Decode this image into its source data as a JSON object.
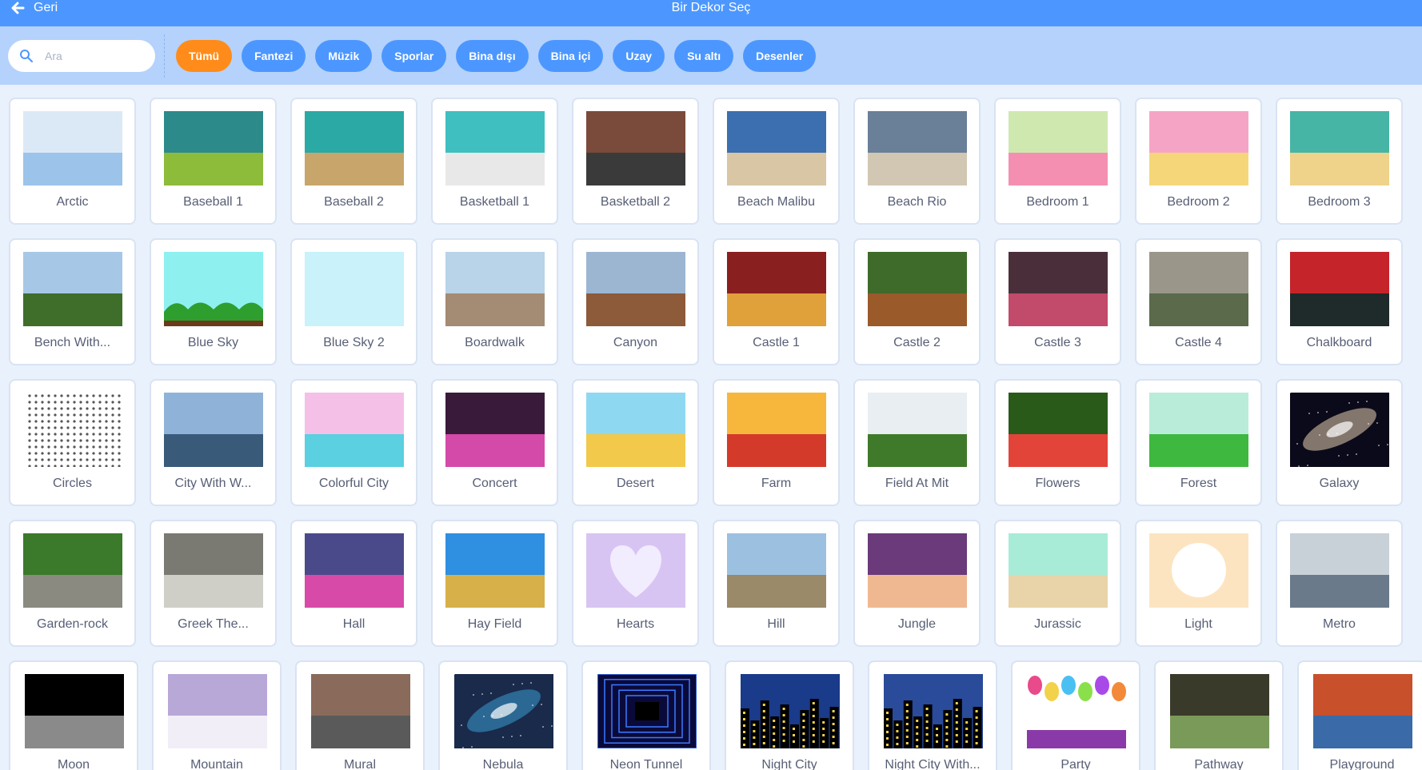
{
  "header": {
    "back_label": "Geri",
    "title": "Bir Dekor Seç"
  },
  "search": {
    "placeholder": "Ara"
  },
  "tags": [
    {
      "label": "Tümü",
      "active": true
    },
    {
      "label": "Fantezi"
    },
    {
      "label": "Müzik"
    },
    {
      "label": "Sporlar"
    },
    {
      "label": "Bina dışı"
    },
    {
      "label": "Bina içi"
    },
    {
      "label": "Uzay"
    },
    {
      "label": "Su altı"
    },
    {
      "label": "Desenler"
    }
  ],
  "rows": [
    [
      {
        "name": "Arctic",
        "icon": "arctic-thumbnail",
        "colors": [
          "#dbe9f7",
          "#9cc3ea"
        ]
      },
      {
        "name": "Baseball 1",
        "icon": "baseball-field-thumbnail",
        "colors": [
          "#2c8a8a",
          "#8dbb3a"
        ]
      },
      {
        "name": "Baseball 2",
        "icon": "baseball-diamond-thumbnail",
        "colors": [
          "#2aa9a5",
          "#c8a56a"
        ]
      },
      {
        "name": "Basketball 1",
        "icon": "basketball-court-thumbnail",
        "colors": [
          "#3fbfc0",
          "#e8e8e8"
        ]
      },
      {
        "name": "Basketball 2",
        "icon": "basketball-building-thumbnail",
        "colors": [
          "#7a4a3a",
          "#3a3a3a"
        ]
      },
      {
        "name": "Beach Malibu",
        "icon": "beach-thumbnail",
        "colors": [
          "#3b6fb0",
          "#d8c6a4"
        ]
      },
      {
        "name": "Beach Rio",
        "icon": "beach-mountain-thumbnail",
        "colors": [
          "#6a7f98",
          "#d2c7b2"
        ]
      },
      {
        "name": "Bedroom 1",
        "icon": "bedroom-thumbnail",
        "colors": [
          "#cfe8b0",
          "#f48fb1"
        ]
      },
      {
        "name": "Bedroom 2",
        "icon": "bedroom-thumbnail",
        "colors": [
          "#f6a4c6",
          "#f5d77a"
        ]
      },
      {
        "name": "Bedroom 3",
        "icon": "bedroom-thumbnail",
        "colors": [
          "#46b5a5",
          "#f0d38a"
        ]
      }
    ],
    [
      {
        "name": "Bench With...",
        "icon": "bench-landscape-thumbnail",
        "colors": [
          "#a7c7e7",
          "#3f6e2a"
        ]
      },
      {
        "name": "Blue Sky",
        "icon": "blue-sky-thumbnail",
        "colors": [
          "#8ff0f0",
          "#2e9e2e"
        ]
      },
      {
        "name": "Blue Sky 2",
        "icon": "blue-sky-thumbnail",
        "colors": [
          "#c9f2fb",
          "#c9f2fb"
        ]
      },
      {
        "name": "Boardwalk",
        "icon": "boardwalk-thumbnail",
        "colors": [
          "#b9d3e8",
          "#a48b73"
        ]
      },
      {
        "name": "Canyon",
        "icon": "canyon-thumbnail",
        "colors": [
          "#9cb6d2",
          "#8d5a3a"
        ]
      },
      {
        "name": "Castle 1",
        "icon": "castle-door-thumbnail",
        "colors": [
          "#8a1f1f",
          "#e0a03a"
        ]
      },
      {
        "name": "Castle 2",
        "icon": "castle-forest-thumbnail",
        "colors": [
          "#3e6b2a",
          "#9a5a2a"
        ]
      },
      {
        "name": "Castle 3",
        "icon": "castle-hall-thumbnail",
        "colors": [
          "#4a2f3a",
          "#c24a6a"
        ]
      },
      {
        "name": "Castle 4",
        "icon": "castle-ruin-thumbnail",
        "colors": [
          "#9a968a",
          "#5a6a4a"
        ]
      },
      {
        "name": "Chalkboard",
        "icon": "chalkboard-thumbnail",
        "colors": [
          "#c4242a",
          "#1f2a2a"
        ]
      }
    ],
    [
      {
        "name": "Circles",
        "icon": "circles-pattern-thumbnail",
        "colors": [
          "#ffffff",
          "#555555"
        ]
      },
      {
        "name": "City With W...",
        "icon": "city-water-thumbnail",
        "colors": [
          "#8fb3d8",
          "#3a5a7a"
        ]
      },
      {
        "name": "Colorful City",
        "icon": "colorful-city-thumbnail",
        "colors": [
          "#f4c0e8",
          "#5ad0e0"
        ]
      },
      {
        "name": "Concert",
        "icon": "concert-stage-thumbnail",
        "colors": [
          "#3a1a3a",
          "#d44aa8"
        ]
      },
      {
        "name": "Desert",
        "icon": "desert-thumbnail",
        "colors": [
          "#8fd8f2",
          "#f2c94a"
        ]
      },
      {
        "name": "Farm",
        "icon": "farm-thumbnail",
        "colors": [
          "#f6b73c",
          "#d43a2a"
        ]
      },
      {
        "name": "Field At Mit",
        "icon": "building-field-thumbnail",
        "colors": [
          "#e8eef2",
          "#3f7a2a"
        ]
      },
      {
        "name": "Flowers",
        "icon": "flowers-thumbnail",
        "colors": [
          "#2a5a1a",
          "#e2443a"
        ]
      },
      {
        "name": "Forest",
        "icon": "forest-thumbnail",
        "colors": [
          "#b9ecd9",
          "#3fb83f"
        ]
      },
      {
        "name": "Galaxy",
        "icon": "galaxy-thumbnail",
        "colors": [
          "#0a0a1a",
          "#e8d0b0"
        ]
      }
    ],
    [
      {
        "name": "Garden-rock",
        "icon": "garden-rock-thumbnail",
        "colors": [
          "#3a7a2a",
          "#8a8a80"
        ]
      },
      {
        "name": "Greek The...",
        "icon": "greek-theater-thumbnail",
        "colors": [
          "#7a7a72",
          "#cfcfc8"
        ]
      },
      {
        "name": "Hall",
        "icon": "hall-thumbnail",
        "colors": [
          "#4a4a8a",
          "#d84aa8"
        ]
      },
      {
        "name": "Hay Field",
        "icon": "hay-field-thumbnail",
        "colors": [
          "#2f8fe0",
          "#d8b04a"
        ]
      },
      {
        "name": "Hearts",
        "icon": "heart-thumbnail",
        "colors": [
          "#d8c4f2",
          "#f2ecff"
        ]
      },
      {
        "name": "Hill",
        "icon": "hill-thumbnail",
        "colors": [
          "#9cc0e0",
          "#9a8a6a"
        ]
      },
      {
        "name": "Jungle",
        "icon": "jungle-thumbnail",
        "colors": [
          "#6a3a7a",
          "#f0b890"
        ]
      },
      {
        "name": "Jurassic",
        "icon": "jurassic-thumbnail",
        "colors": [
          "#a8ecd8",
          "#e8d4a8"
        ]
      },
      {
        "name": "Light",
        "icon": "light-thumbnail",
        "colors": [
          "#fde4c0",
          "#ffffff"
        ]
      },
      {
        "name": "Metro",
        "icon": "metro-city-thumbnail",
        "colors": [
          "#c8d0d8",
          "#6a7a8a"
        ]
      }
    ],
    [
      {
        "name": "Moon",
        "icon": "moon-surface-thumbnail",
        "colors": [
          "#000000",
          "#8a8a8a"
        ]
      },
      {
        "name": "Mountain",
        "icon": "mountain-thumbnail",
        "colors": [
          "#b8a8d8",
          "#f2eef8"
        ]
      },
      {
        "name": "Mural",
        "icon": "mural-thumbnail",
        "colors": [
          "#8a6a5a",
          "#5a5a5a"
        ]
      },
      {
        "name": "Nebula",
        "icon": "nebula-thumbnail",
        "colors": [
          "#1a2a4a",
          "#3a9ad0"
        ]
      },
      {
        "name": "Neon Tunnel",
        "icon": "neon-tunnel-thumbnail",
        "colors": [
          "#0a0a3a",
          "#3a7aff"
        ]
      },
      {
        "name": "Night City",
        "icon": "night-city-thumbnail",
        "colors": [
          "#1a3a8a",
          "#000000"
        ]
      },
      {
        "name": "Night City With...",
        "icon": "night-city-thumbnail",
        "colors": [
          "#2a4a9a",
          "#000000"
        ]
      },
      {
        "name": "Party",
        "icon": "party-balloons-thumbnail",
        "colors": [
          "#ffffff",
          "#8a3aa8"
        ]
      },
      {
        "name": "Pathway",
        "icon": "pathway-thumbnail",
        "colors": [
          "#3a3a2a",
          "#7a9a5a"
        ]
      },
      {
        "name": "Playground",
        "icon": "playground-thumbnail",
        "colors": [
          "#c8502a",
          "#3a6aa8"
        ]
      }
    ]
  ]
}
